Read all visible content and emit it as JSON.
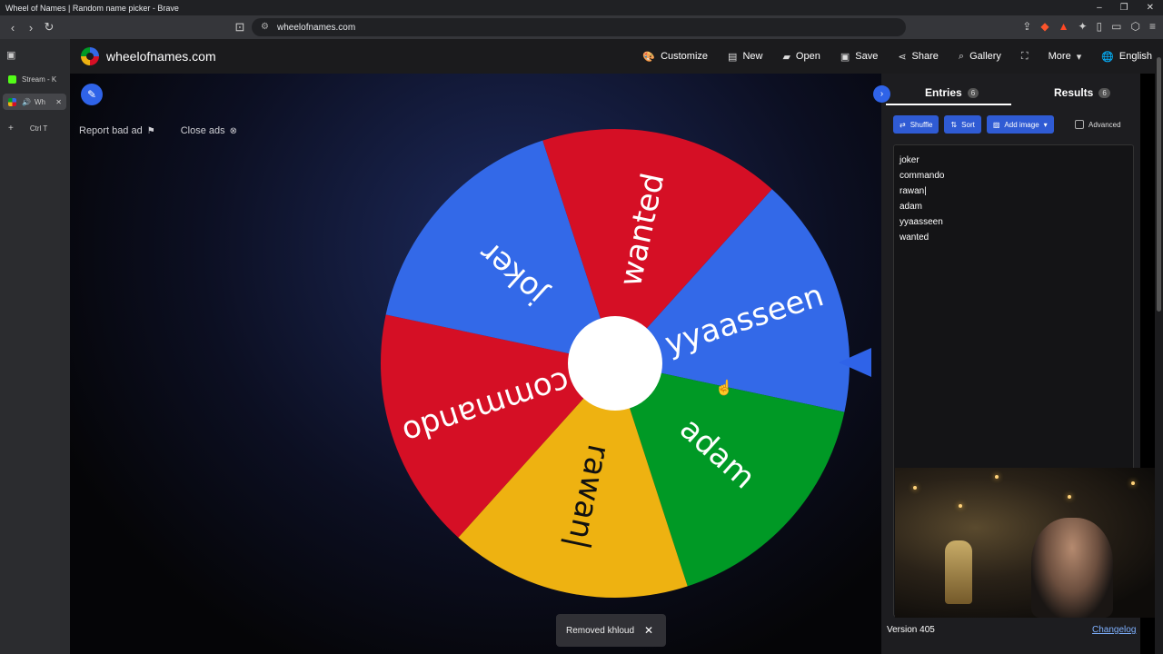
{
  "browser": {
    "window_title": "Wheel of Names | Random name picker - Brave",
    "url": "wheelofnames.com",
    "tabs": [
      {
        "label": "Stream - K",
        "color": "#53fc18"
      },
      {
        "label": "Wh",
        "color": "#3369e8"
      },
      {
        "label": "Ctrl T",
        "color": "#2b2c2f"
      }
    ]
  },
  "app": {
    "brand": "wheelofnames.com",
    "menu": [
      {
        "icon": "palette-icon",
        "label": "Customize"
      },
      {
        "icon": "file-icon",
        "label": "New"
      },
      {
        "icon": "folder-icon",
        "label": "Open"
      },
      {
        "icon": "save-icon",
        "label": "Save"
      },
      {
        "icon": "share-icon",
        "label": "Share"
      },
      {
        "icon": "search-icon",
        "label": "Gallery"
      },
      {
        "icon": "fullscreen-icon",
        "label": ""
      },
      {
        "icon": "chevron-down-icon",
        "label": "More"
      },
      {
        "icon": "globe-icon",
        "label": "English"
      }
    ]
  },
  "ads": {
    "report": "Report bad ad",
    "close": "Close ads"
  },
  "wheel": {
    "segments": [
      {
        "label": "yyaasseen",
        "color": "#3369e8"
      },
      {
        "label": "adam",
        "color": "#009925"
      },
      {
        "label": "rawan|",
        "color": "#eeb211"
      },
      {
        "label": "commando",
        "color": "#d50f25"
      },
      {
        "label": "joker",
        "color": "#3369e8"
      },
      {
        "label": "wanted",
        "color": "#d50f25"
      }
    ]
  },
  "toast": {
    "message": "Removed khloud"
  },
  "panel": {
    "tabs": [
      {
        "label": "Entries",
        "count": "6"
      },
      {
        "label": "Results",
        "count": "6"
      }
    ],
    "tools": {
      "shuffle": "Shuffle",
      "sort": "Sort",
      "add_image": "Add image",
      "advanced": "Advanced"
    },
    "entries": [
      "joker",
      "commando",
      "rawan|",
      "adam",
      "yyaasseen",
      "wanted"
    ],
    "version": "Version 405",
    "changelog": "Changelog"
  }
}
